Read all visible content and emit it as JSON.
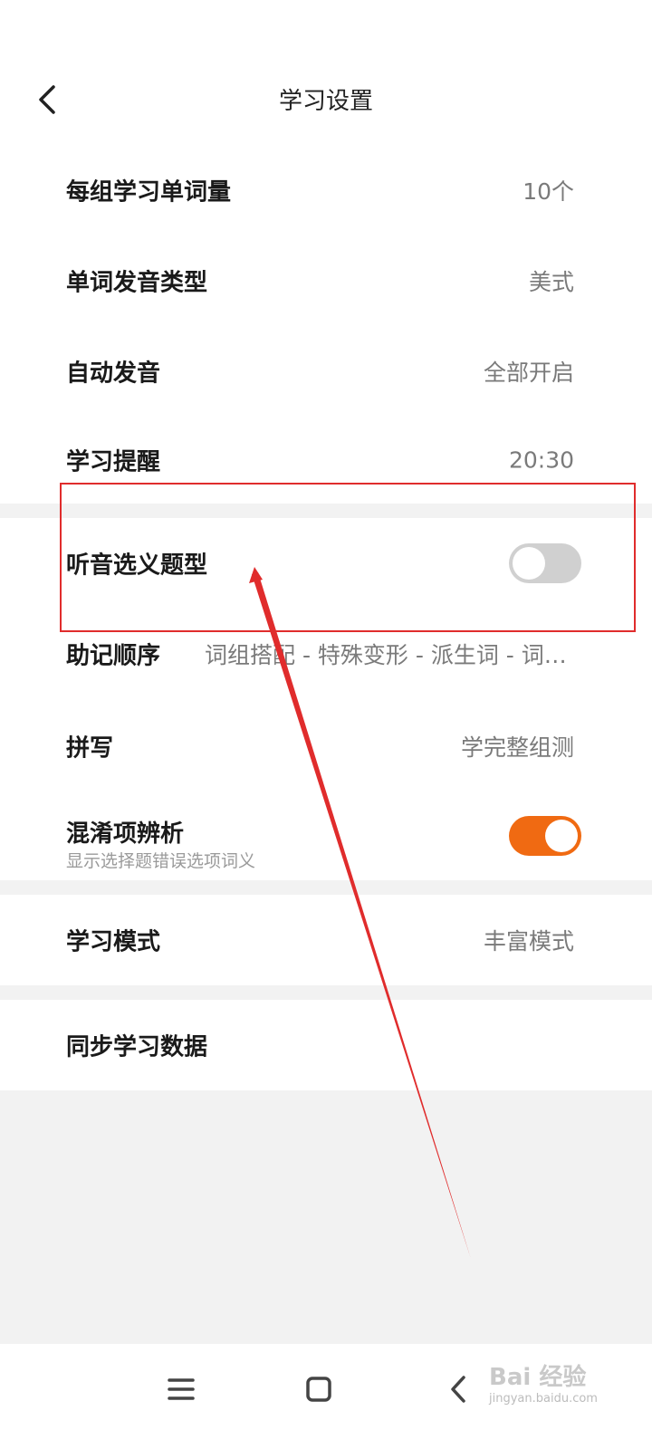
{
  "header": {
    "title": "学习设置"
  },
  "settings": {
    "words_per_group": {
      "label": "每组学习单词量",
      "value": "10个"
    },
    "pronunciation_type": {
      "label": "单词发音类型",
      "value": "美式"
    },
    "auto_pronounce": {
      "label": "自动发音",
      "value": "全部开启"
    },
    "study_reminder": {
      "label": "学习提醒",
      "value": "20:30"
    },
    "listening_choice": {
      "label": "听音选义题型",
      "toggle": "off"
    },
    "mnemonic_order": {
      "label": "助记顺序",
      "value": "词组搭配 - 特殊变形 - 派生词 - 词…"
    },
    "spelling": {
      "label": "拼写",
      "value": "学完整组测"
    },
    "confusion_analysis": {
      "label": "混淆项辨析",
      "sublabel": "显示选择题错误选项词义",
      "toggle": "on"
    },
    "study_mode": {
      "label": "学习模式",
      "value": "丰富模式"
    },
    "sync_data": {
      "label": "同步学习数据"
    }
  },
  "colors": {
    "accent": "#f06a12",
    "toggle_off": "#d0d0d0",
    "annotation": "#e02c2c",
    "background": "#f2f2f2"
  },
  "watermark": {
    "text": "Bai 经验",
    "sub": "jingyan.baidu.com"
  },
  "icons": {
    "back": "chevron-left-icon",
    "nav_menu": "menu-icon",
    "nav_home": "square-home-icon",
    "nav_back": "chevron-left-icon"
  }
}
